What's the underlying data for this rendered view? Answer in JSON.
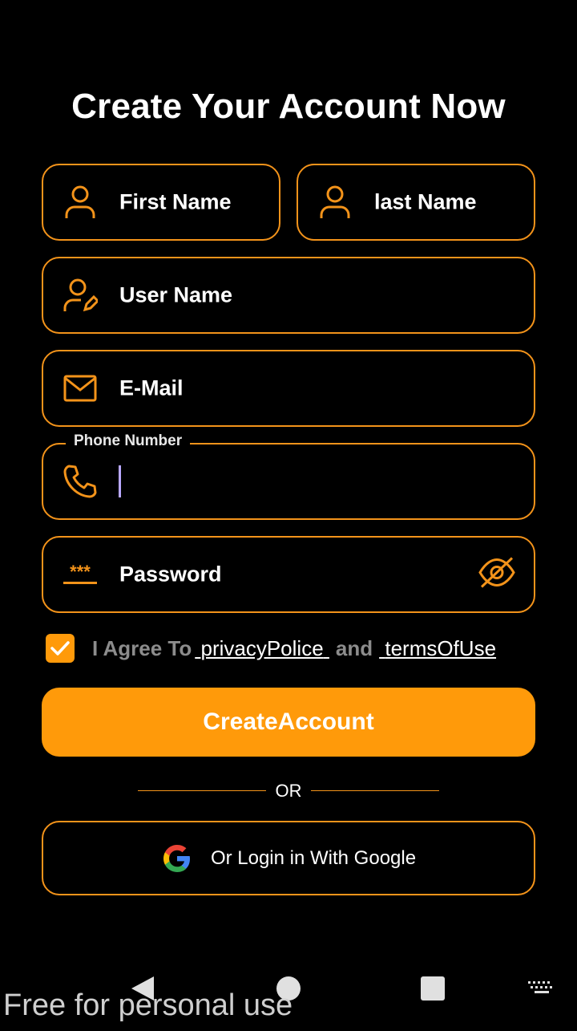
{
  "page": {
    "title": "Create Your Account Now"
  },
  "fields": {
    "first_name": {
      "placeholder": "First Name"
    },
    "last_name": {
      "placeholder": "last Name"
    },
    "user_name": {
      "placeholder": "User Name"
    },
    "email": {
      "placeholder": "E-Mail"
    },
    "phone": {
      "label": "Phone Number",
      "value": ""
    },
    "password": {
      "placeholder": "Password",
      "mask_glyph": "***"
    }
  },
  "agreement": {
    "checked": true,
    "prefix": "I Agree To",
    "privacy_link": "privacyPolice",
    "conjunction": "and",
    "terms_link": "termsOfUse"
  },
  "actions": {
    "create_label": "CreateAccount",
    "divider_text": "OR",
    "google_label": "Or Login in With Google"
  },
  "watermark": "Free for personal use",
  "colors": {
    "accent": "#ff9a0a",
    "border": "#f3931a",
    "background": "#000000"
  }
}
